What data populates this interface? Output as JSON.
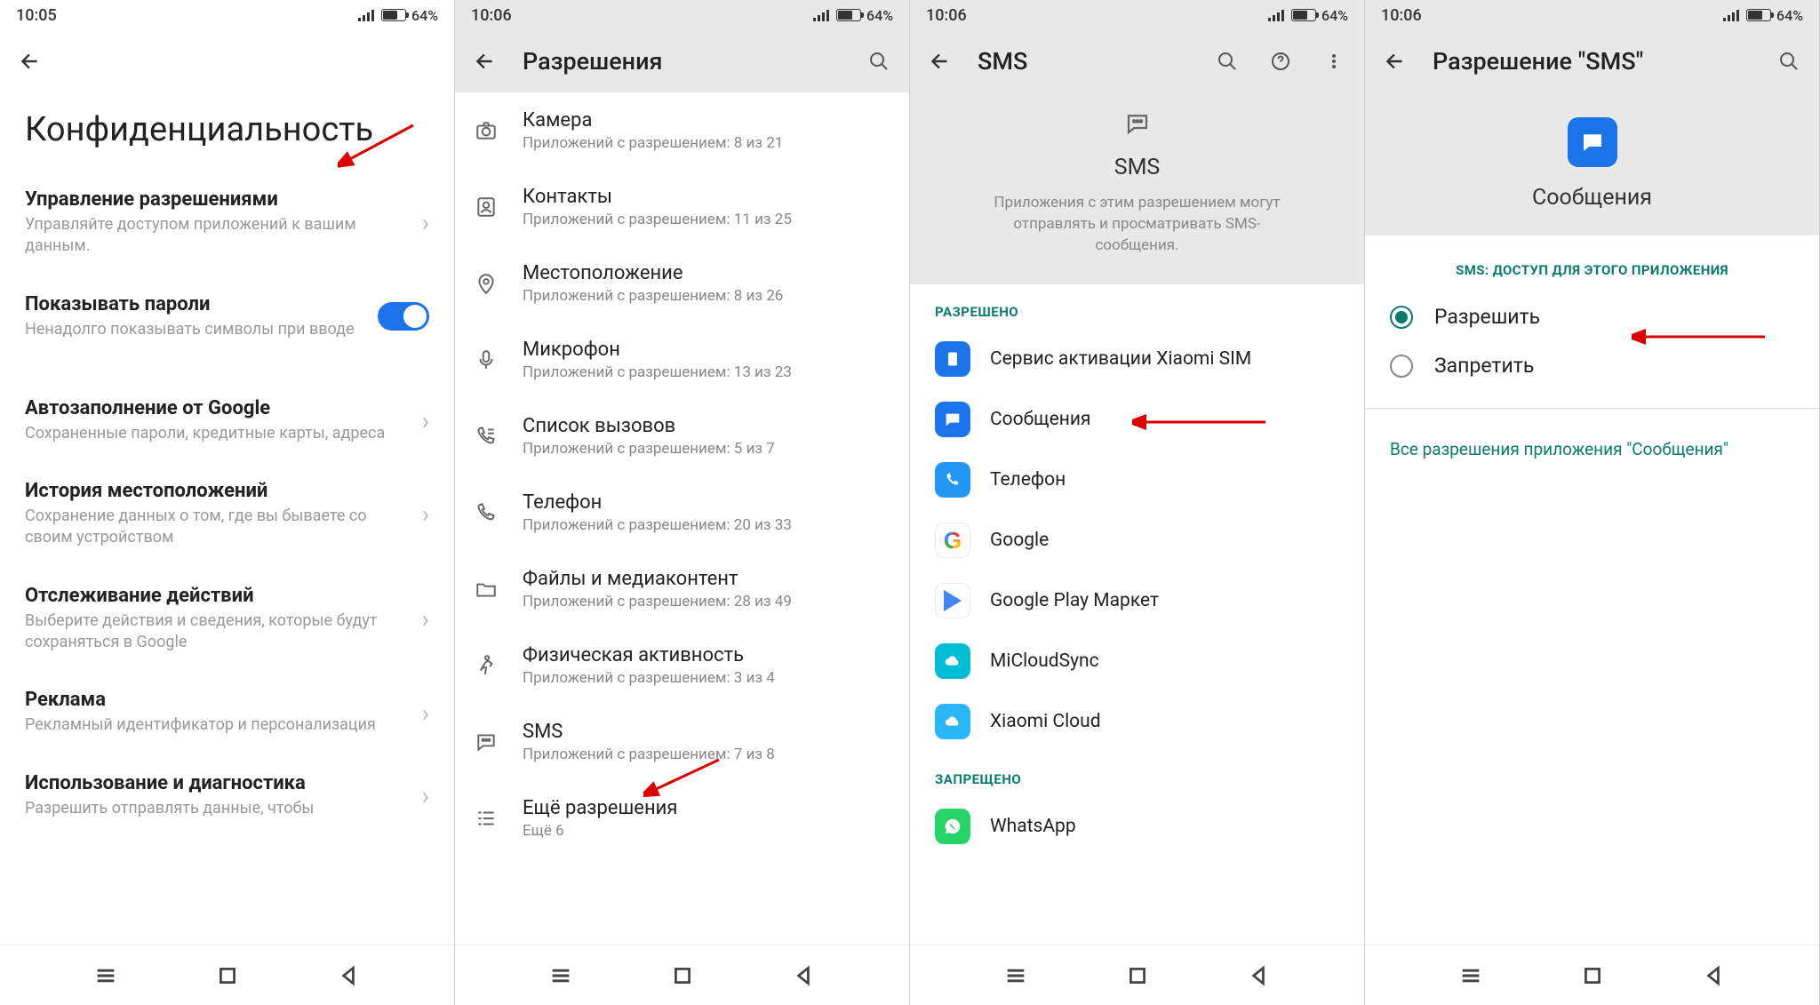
{
  "status": {
    "time_a": "10:05",
    "time_b": "10:06",
    "battery": "64%"
  },
  "pane1": {
    "title": "Конфиденциальность",
    "items": [
      {
        "title": "Управление разрешениями",
        "sub": "Управляйте доступом приложений к вашим данным."
      },
      {
        "title": "Показывать пароли",
        "sub": "Ненадолго показывать символы при вводе",
        "switch": true
      },
      {
        "title": "Автозаполнение от Google",
        "sub": "Сохраненные пароли, кредитные карты, адреса"
      },
      {
        "title": "История местоположений",
        "sub": "Сохранение данных о том, где вы бываете со своим устройством"
      },
      {
        "title": "Отслеживание действий",
        "sub": "Выберите действия и сведения, которые будут сохраняться в Google"
      },
      {
        "title": "Реклама",
        "sub": "Рекламный идентификатор и персонализация"
      },
      {
        "title": "Использование и диагностика",
        "sub": "Разрешить отправлять данные, чтобы"
      }
    ]
  },
  "pane2": {
    "title": "Разрешения",
    "rows": [
      {
        "title": "Камера",
        "sub": "Приложений с разрешением: 8 из 21"
      },
      {
        "title": "Контакты",
        "sub": "Приложений с разрешением: 11 из 25"
      },
      {
        "title": "Местоположение",
        "sub": "Приложений с разрешением: 8 из 26"
      },
      {
        "title": "Микрофон",
        "sub": "Приложений с разрешением: 13 из 23"
      },
      {
        "title": "Список вызовов",
        "sub": "Приложений с разрешением: 5 из 7"
      },
      {
        "title": "Телефон",
        "sub": "Приложений с разрешением: 20 из 33"
      },
      {
        "title": "Файлы и медиаконтент",
        "sub": "Приложений с разрешением: 28 из 49"
      },
      {
        "title": "Физическая активность",
        "sub": "Приложений с разрешением: 3 из 4"
      },
      {
        "title": "SMS",
        "sub": "Приложений с разрешением: 7 из 8"
      },
      {
        "title": "Ещё разрешения",
        "sub": "Ещё 6"
      }
    ]
  },
  "pane3": {
    "title": "SMS",
    "hero_title": "SMS",
    "hero_desc": "Приложения с этим разрешением могут отправлять и просматривать SMS-сообщения.",
    "section_allowed": "РАЗРЕШЕНО",
    "section_denied": "ЗАПРЕЩЕНО",
    "allowed": [
      "Сервис активации Xiaomi SIM",
      "Сообщения",
      "Телефон",
      "Google",
      "Google Play Маркет",
      "MiCloudSync",
      "Xiaomi Cloud"
    ],
    "denied": [
      "WhatsApp"
    ]
  },
  "pane4": {
    "title": "Разрешение \"SMS\"",
    "app_name": "Сообщения",
    "section_label": "SMS: ДОСТУП ДЛЯ ЭТОГО ПРИЛОЖЕНИЯ",
    "opt_allow": "Разрешить",
    "opt_deny": "Запретить",
    "link": "Все разрешения приложения \"Сообщения\""
  }
}
